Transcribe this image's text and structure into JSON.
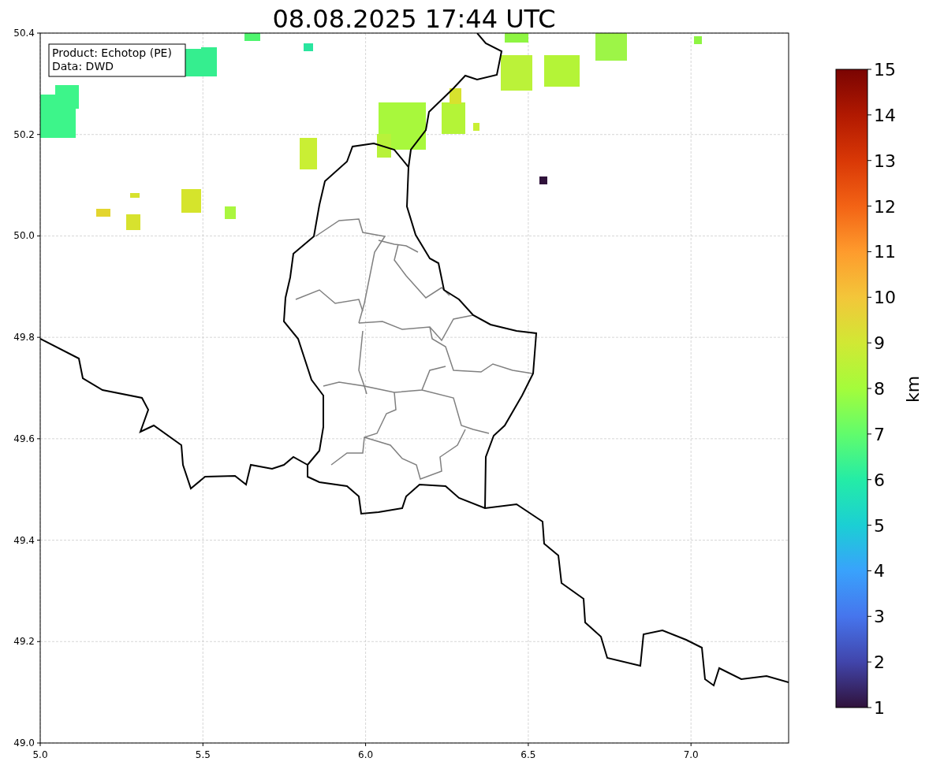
{
  "title": "08.08.2025 17:44 UTC",
  "map": {
    "xticks": [
      "5.0",
      "5.5",
      "6.0",
      "6.5",
      "7.0"
    ],
    "yticks": [
      "50.4",
      "50.2",
      "50.0",
      "49.8",
      "49.6",
      "49.4",
      "49.2",
      "49.0"
    ],
    "legend": [
      "Product: Echotop (PE)",
      "Data: DWD"
    ]
  },
  "colorbar": {
    "label": "km",
    "ticks": [
      "15",
      "14",
      "13",
      "12",
      "11",
      "10",
      "9",
      "8",
      "7",
      "6",
      "5",
      "4",
      "3",
      "2",
      "1"
    ]
  }
}
